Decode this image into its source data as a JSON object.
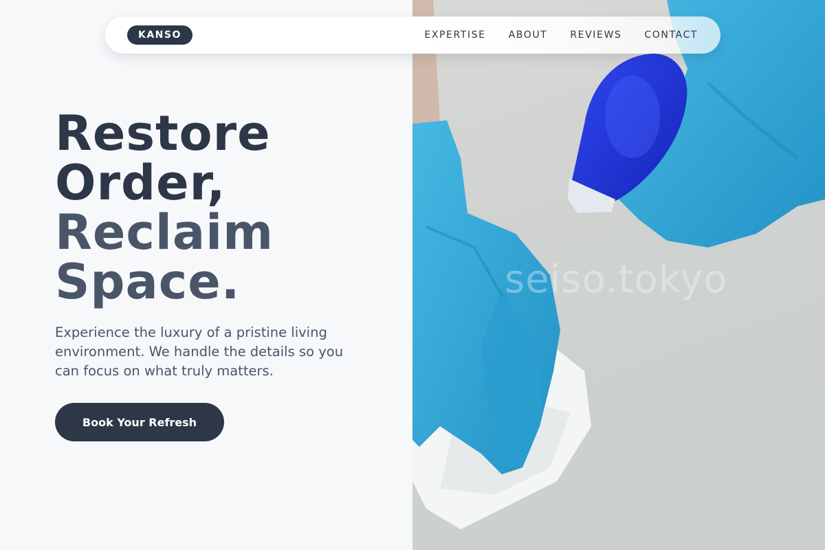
{
  "nav": {
    "logo": "KANSO",
    "links": [
      "EXPERTISE",
      "ABOUT",
      "REVIEWS",
      "CONTACT"
    ]
  },
  "hero": {
    "title_line1": "Restore",
    "title_line2": "Order,",
    "title_line3": "Reclaim",
    "title_line4": "Space.",
    "subtitle": "Experience the luxury of a pristine living environment. We handle the details so you can focus on what truly matters.",
    "cta_label": "Book Your Refresh"
  },
  "image": {
    "watermark": "seiso.tokyo",
    "subject": "gloved-hands-cleaning-with-spray-bottle-and-cloth"
  },
  "colors": {
    "primary": "#2d3748",
    "secondary": "#4a5568",
    "background": "#f6f8fa",
    "glove": "#2fa5d6",
    "spray_bottle": "#1a2fd6"
  }
}
